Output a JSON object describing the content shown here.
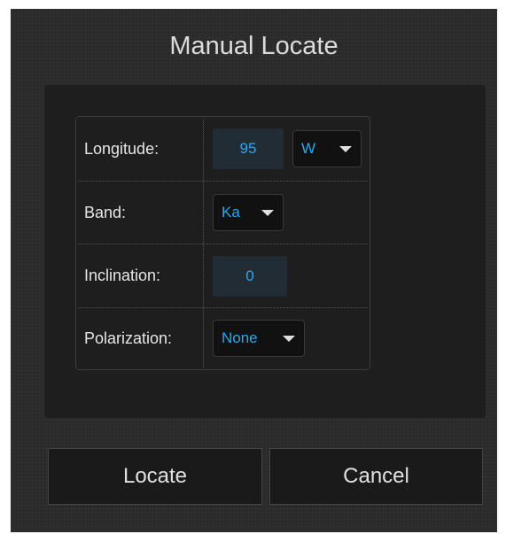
{
  "dialog": {
    "title": "Manual Locate"
  },
  "form": {
    "longitude": {
      "label": "Longitude:",
      "value": "95",
      "hemisphere": "W"
    },
    "band": {
      "label": "Band:",
      "value": "Ka"
    },
    "inclination": {
      "label": "Inclination:",
      "value": "0"
    },
    "polarization": {
      "label": "Polarization:",
      "value": "None"
    }
  },
  "buttons": {
    "locate_label": "Locate",
    "cancel_label": "Cancel"
  },
  "colors": {
    "dialog_background": "#2a2a2a",
    "panel_background": "#1e1e1e",
    "value_text": "#29a9ec",
    "label_text": "#e6e6e6",
    "input_background": "#222c35"
  },
  "icons": {
    "dropdown": "chevron-down-icon"
  }
}
